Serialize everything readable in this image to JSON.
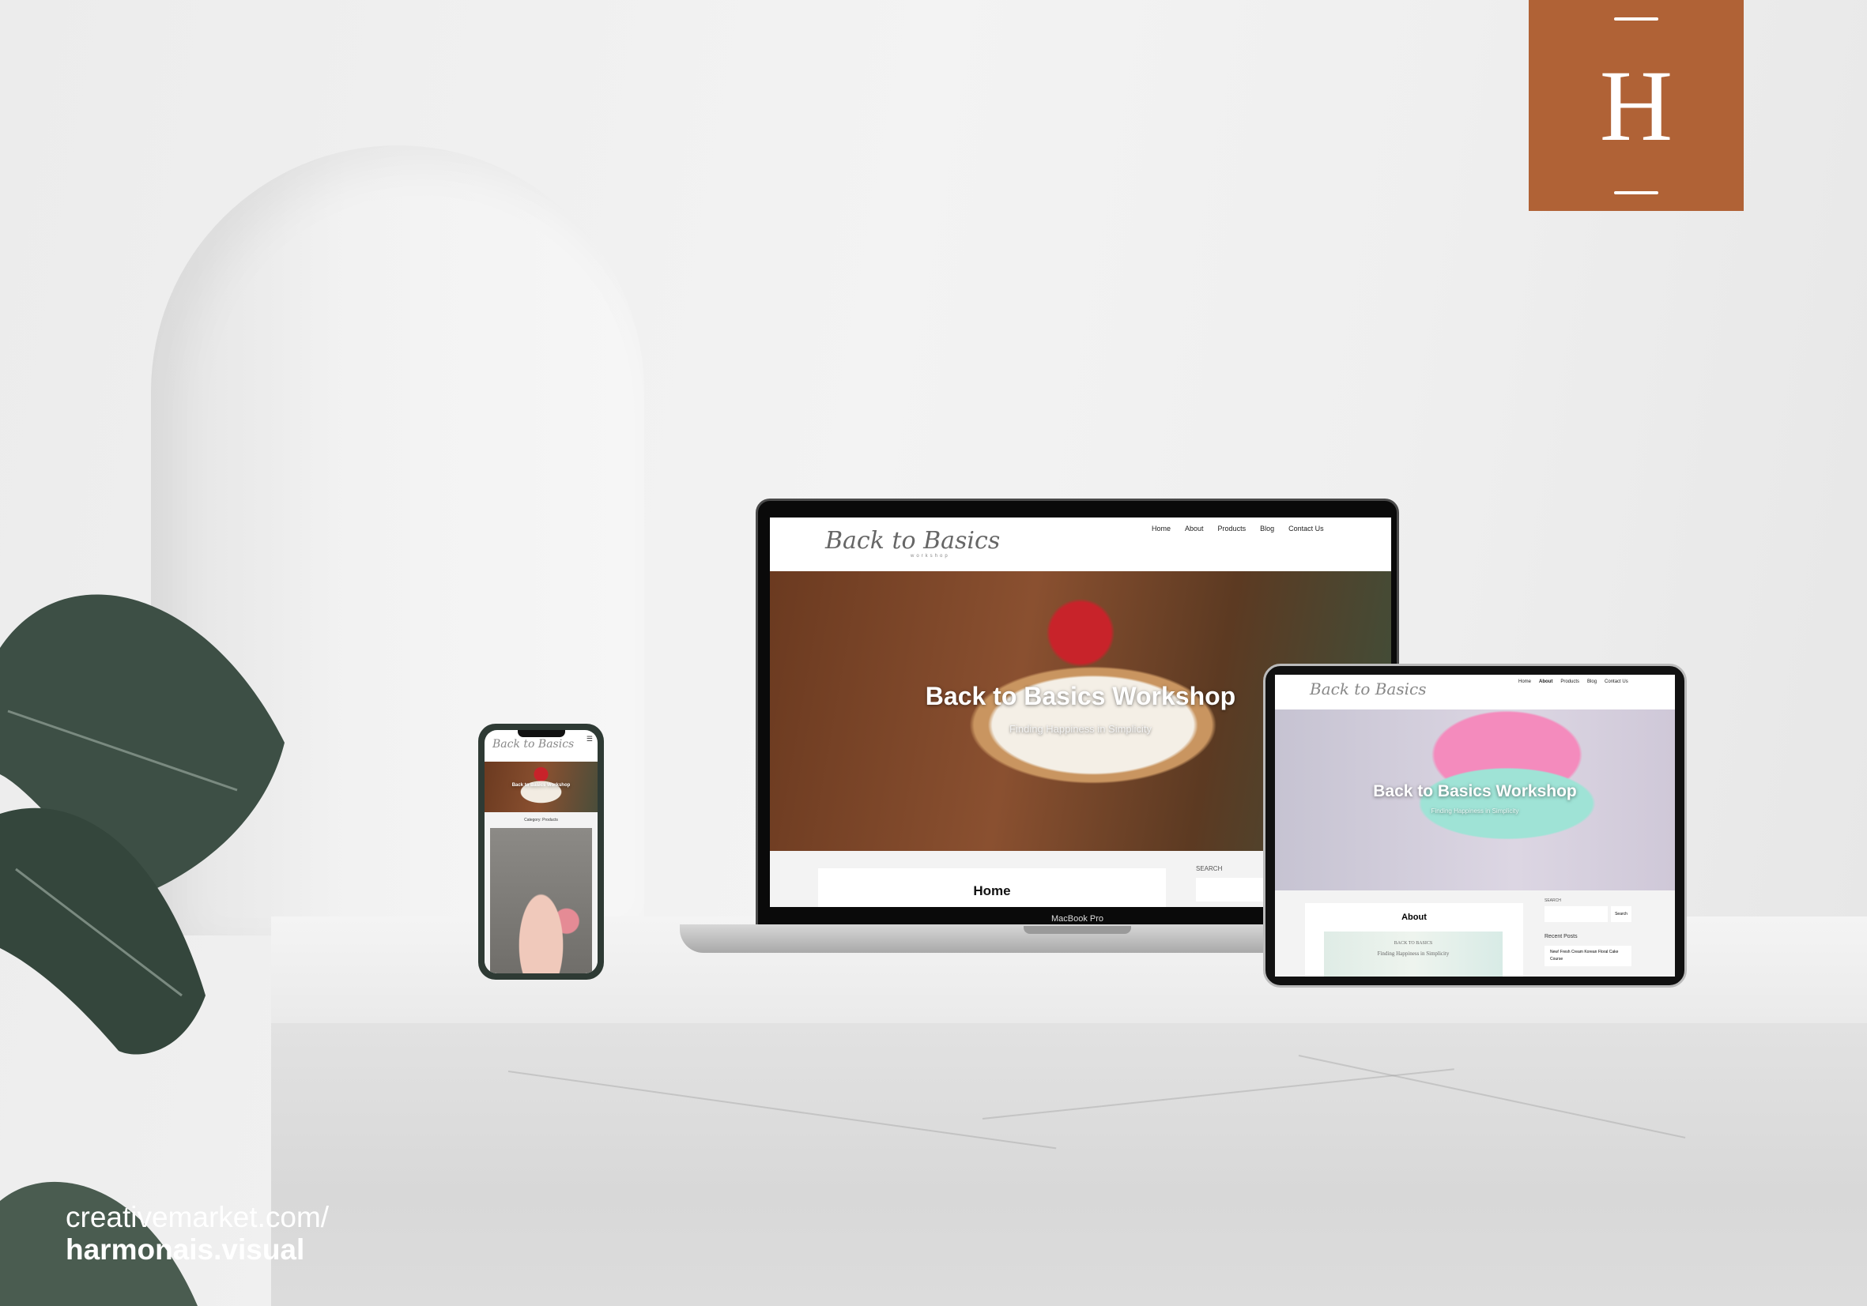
{
  "brand_logo": {
    "letter": "H",
    "color": "#b06236"
  },
  "credit": {
    "line1": "creativemarket.com/",
    "line2": "harmonais.visual"
  },
  "site": {
    "logo_script": "Back to Basics",
    "logo_sub": "workshop",
    "nav": [
      "Home",
      "About",
      "Products",
      "Blog",
      "Contact Us"
    ],
    "hero_title": "Back to Basics Workshop",
    "hero_subtitle": "Finding Happiness in Simplicity"
  },
  "laptop": {
    "label": "MacBook Pro",
    "page_title": "Home",
    "sidebar_search_label": "SEARCH"
  },
  "tablet": {
    "page_title": "About",
    "card_title": "Back to Basics",
    "card_subtitle": "Finding Happiness in Simplicity",
    "search_label": "SEARCH",
    "search_button": "Search",
    "recent_posts_title": "Recent Posts",
    "recent_post": "New! Fresh Cream Korean Floral Cake Course"
  },
  "phone": {
    "category_title": "Category: Products",
    "menu_icon": "hamburger-icon"
  }
}
